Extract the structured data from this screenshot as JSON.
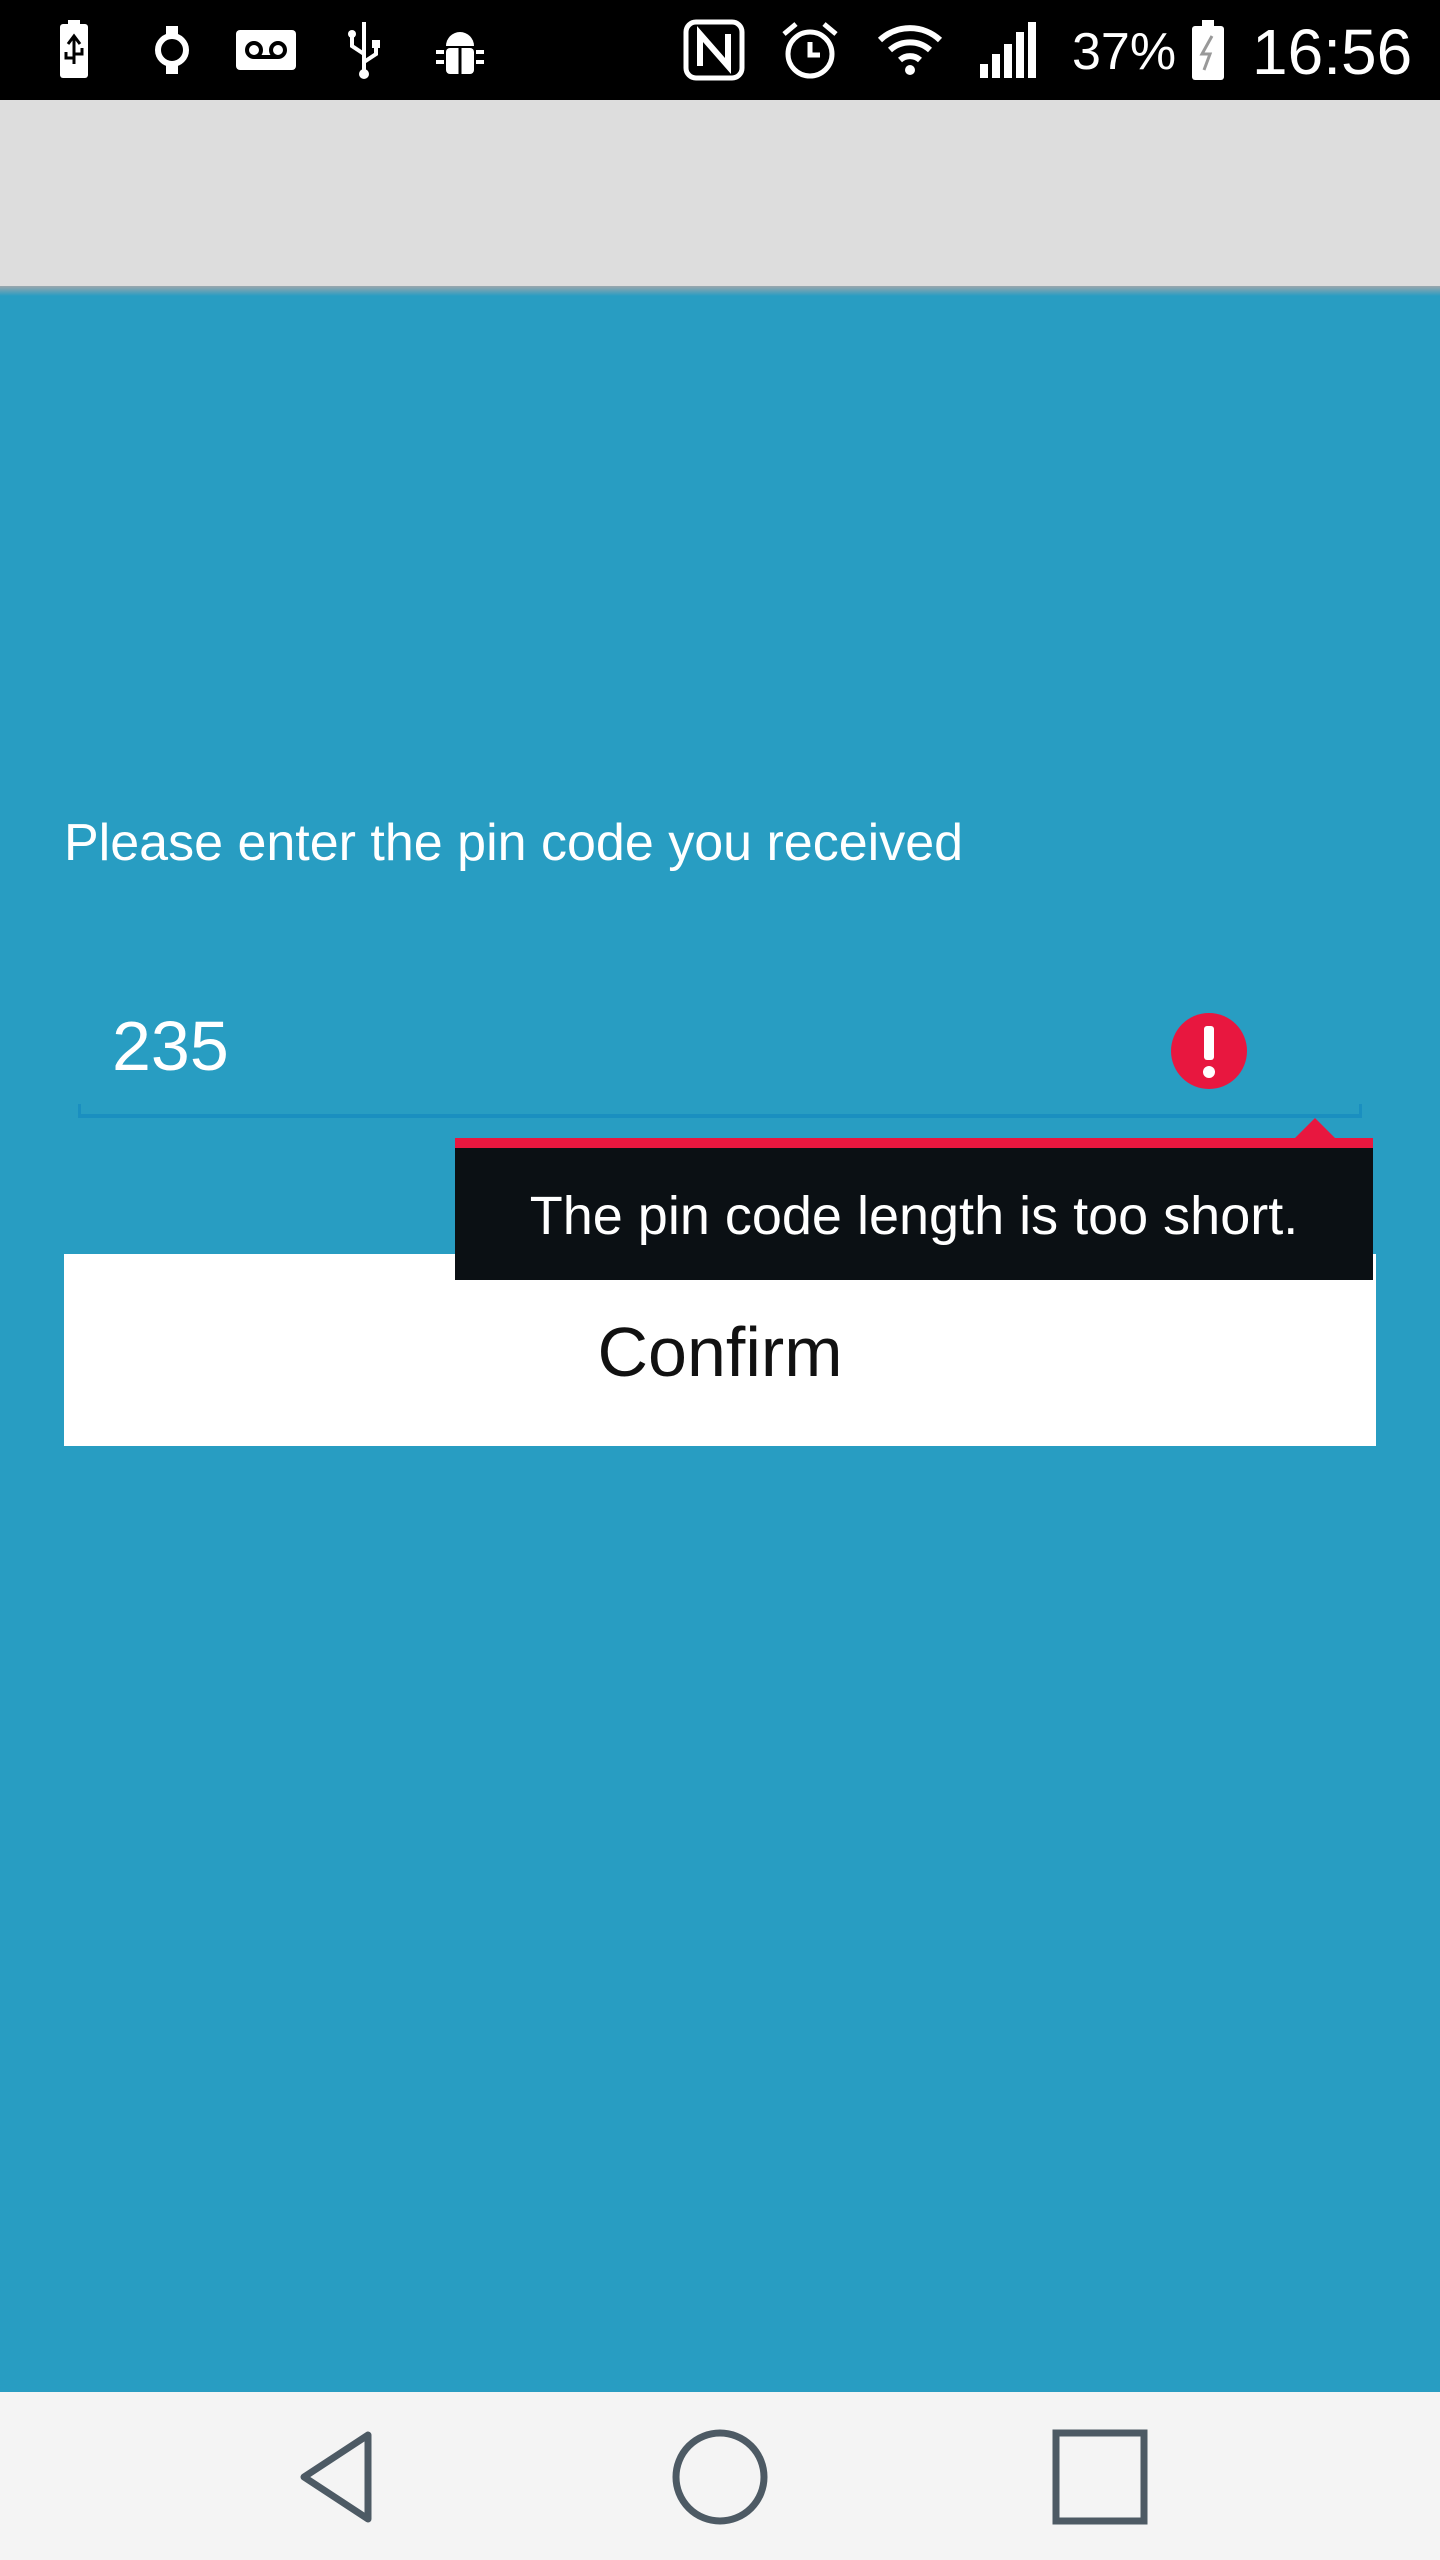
{
  "status_bar": {
    "left_icons": [
      "battery-charging-icon",
      "smartwatch-icon",
      "voicemail-icon",
      "usb-icon",
      "android-debug-icon"
    ],
    "right_icons": [
      "nfc-icon",
      "alarm-icon",
      "wifi-icon",
      "cell-signal-icon",
      "battery-icon"
    ],
    "battery_percent": "37%",
    "time": "16:56"
  },
  "app_bar": {
    "title": ""
  },
  "pin_form": {
    "prompt": "Please enter the pin code you received",
    "pin_value": "235",
    "error_icon": "error-icon",
    "error_message": "The pin code length is too short.",
    "confirm_label": "Confirm"
  },
  "nav_bar": {
    "buttons": [
      "back-icon",
      "home-icon",
      "recents-icon"
    ]
  },
  "colors": {
    "background": "#289dc2",
    "app_bar": "#dddddd",
    "error": "#e8173f",
    "tooltip": "#0b1014",
    "button": "#ffffff",
    "nav_bar": "#f4f4f4"
  }
}
